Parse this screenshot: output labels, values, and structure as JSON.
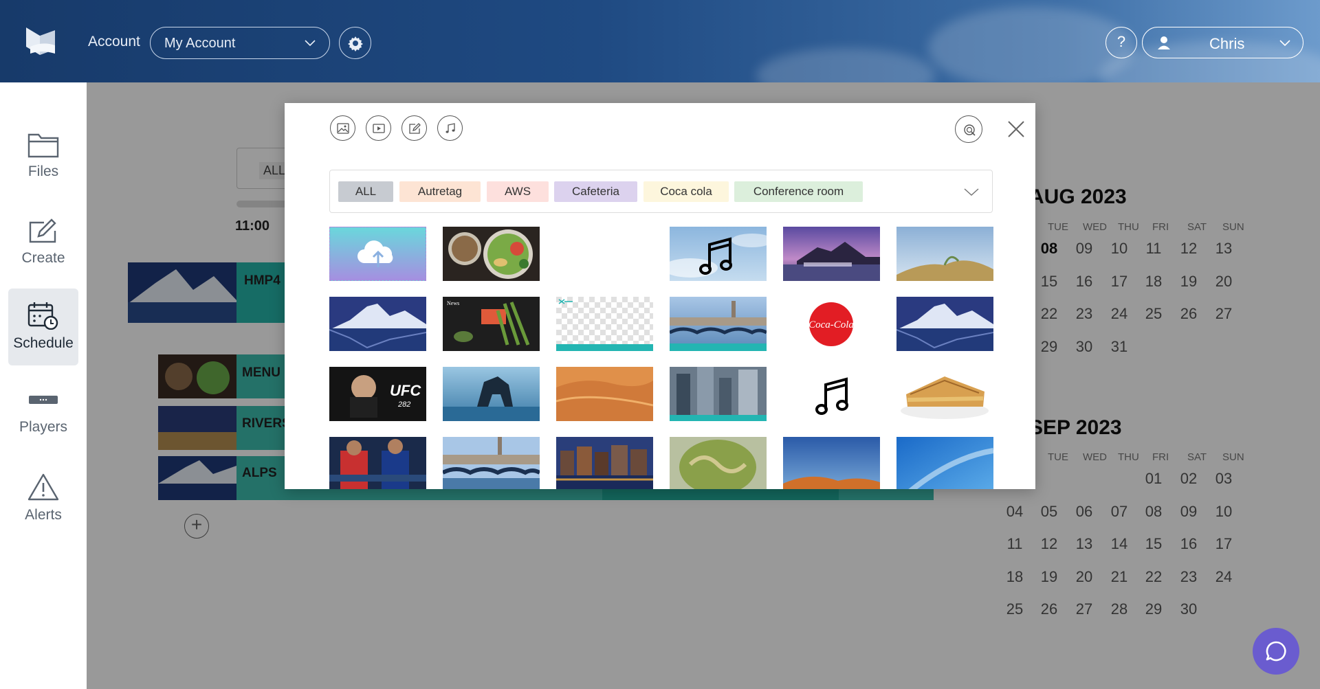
{
  "header": {
    "account_label": "Account",
    "account_select_value": "My Account",
    "help_label": "?",
    "user_name": "Chris"
  },
  "sidebar": {
    "items": [
      {
        "label": "Files",
        "icon": "folder-icon"
      },
      {
        "label": "Create",
        "icon": "edit-icon"
      },
      {
        "label": "Schedule",
        "icon": "calendar-clock-icon",
        "active": true
      },
      {
        "label": "Players",
        "icon": "player-device-icon"
      },
      {
        "label": "Alerts",
        "icon": "warning-icon"
      }
    ]
  },
  "background": {
    "filter_pill": "ALL",
    "time": "11:00",
    "rows": [
      "HMP4",
      "MENU",
      "RIVERS",
      "ALPS"
    ]
  },
  "calendars": [
    {
      "title": "AUG 2023",
      "dow": [
        "ON",
        "TUE",
        "WED",
        "THU",
        "FRI",
        "SAT",
        "SUN"
      ],
      "weeks": [
        [
          "",
          "08",
          "09",
          "10",
          "11",
          "12",
          "13"
        ],
        [
          "4",
          "15",
          "16",
          "17",
          "18",
          "19",
          "20"
        ],
        [
          "1",
          "22",
          "23",
          "24",
          "25",
          "26",
          "27"
        ],
        [
          "8",
          "29",
          "30",
          "31",
          "",
          "",
          ""
        ]
      ]
    },
    {
      "title": "SEP 2023",
      "dow": [
        "ON",
        "TUE",
        "WED",
        "THU",
        "FRI",
        "SAT",
        "SUN"
      ],
      "weeks": [
        [
          "",
          "",
          "",
          "",
          "01",
          "02",
          "03"
        ],
        [
          "04",
          "05",
          "06",
          "07",
          "08",
          "09",
          "10"
        ],
        [
          "11",
          "12",
          "13",
          "14",
          "15",
          "16",
          "17"
        ],
        [
          "18",
          "19",
          "20",
          "21",
          "22",
          "23",
          "24"
        ],
        [
          "25",
          "26",
          "27",
          "28",
          "29",
          "30",
          ""
        ]
      ]
    }
  ],
  "modal": {
    "type_filters": [
      "image-icon",
      "video-icon",
      "edit-icon",
      "music-icon"
    ],
    "tags": [
      {
        "label": "ALL",
        "color": "#c7cbd1"
      },
      {
        "label": "Autretag",
        "color": "#fde4d4"
      },
      {
        "label": "AWS",
        "color": "#fde0dd"
      },
      {
        "label": "Cafeteria",
        "color": "#dcd2ee"
      },
      {
        "label": "Coca cola",
        "color": "#fdf6dd"
      },
      {
        "label": "Conference room",
        "color": "#dcefdc"
      }
    ],
    "media": [
      {
        "name": "upload-tile"
      },
      {
        "name": "food-bowl-thumbnail"
      },
      {
        "name": "empty-slot"
      },
      {
        "name": "music-sky-thumbnail"
      },
      {
        "name": "harbor-dusk-thumbnail"
      },
      {
        "name": "rocky-shore-thumbnail"
      },
      {
        "name": "mountain-lake-thumbnail"
      },
      {
        "name": "news-layout-thumbnail"
      },
      {
        "name": "transparent-template-thumbnail"
      },
      {
        "name": "venice-gondolas-thumbnail"
      },
      {
        "name": "coca-cola-logo-thumbnail"
      },
      {
        "name": "mountain-lake-thumbnail-2"
      },
      {
        "name": "ufc-news-thumbnail"
      },
      {
        "name": "sea-arch-rock-thumbnail"
      },
      {
        "name": "desert-dunes-thumbnail"
      },
      {
        "name": "city-skyscrapers-thumbnail"
      },
      {
        "name": "music-note-thumbnail"
      },
      {
        "name": "grilled-sandwich-thumbnail"
      },
      {
        "name": "football-players-thumbnail"
      },
      {
        "name": "venice-gondolas-thumbnail-2"
      },
      {
        "name": "amsterdam-canal-thumbnail"
      },
      {
        "name": "green-planet-thumbnail"
      },
      {
        "name": "desert-sky-thumbnail"
      },
      {
        "name": "blue-sky-thumbnail"
      }
    ],
    "coca_cola_text": "Coca-Cola",
    "ufc_text": "UFC",
    "ufc_number": "282",
    "news_text": "News",
    "zurich_text": "Zurich"
  }
}
